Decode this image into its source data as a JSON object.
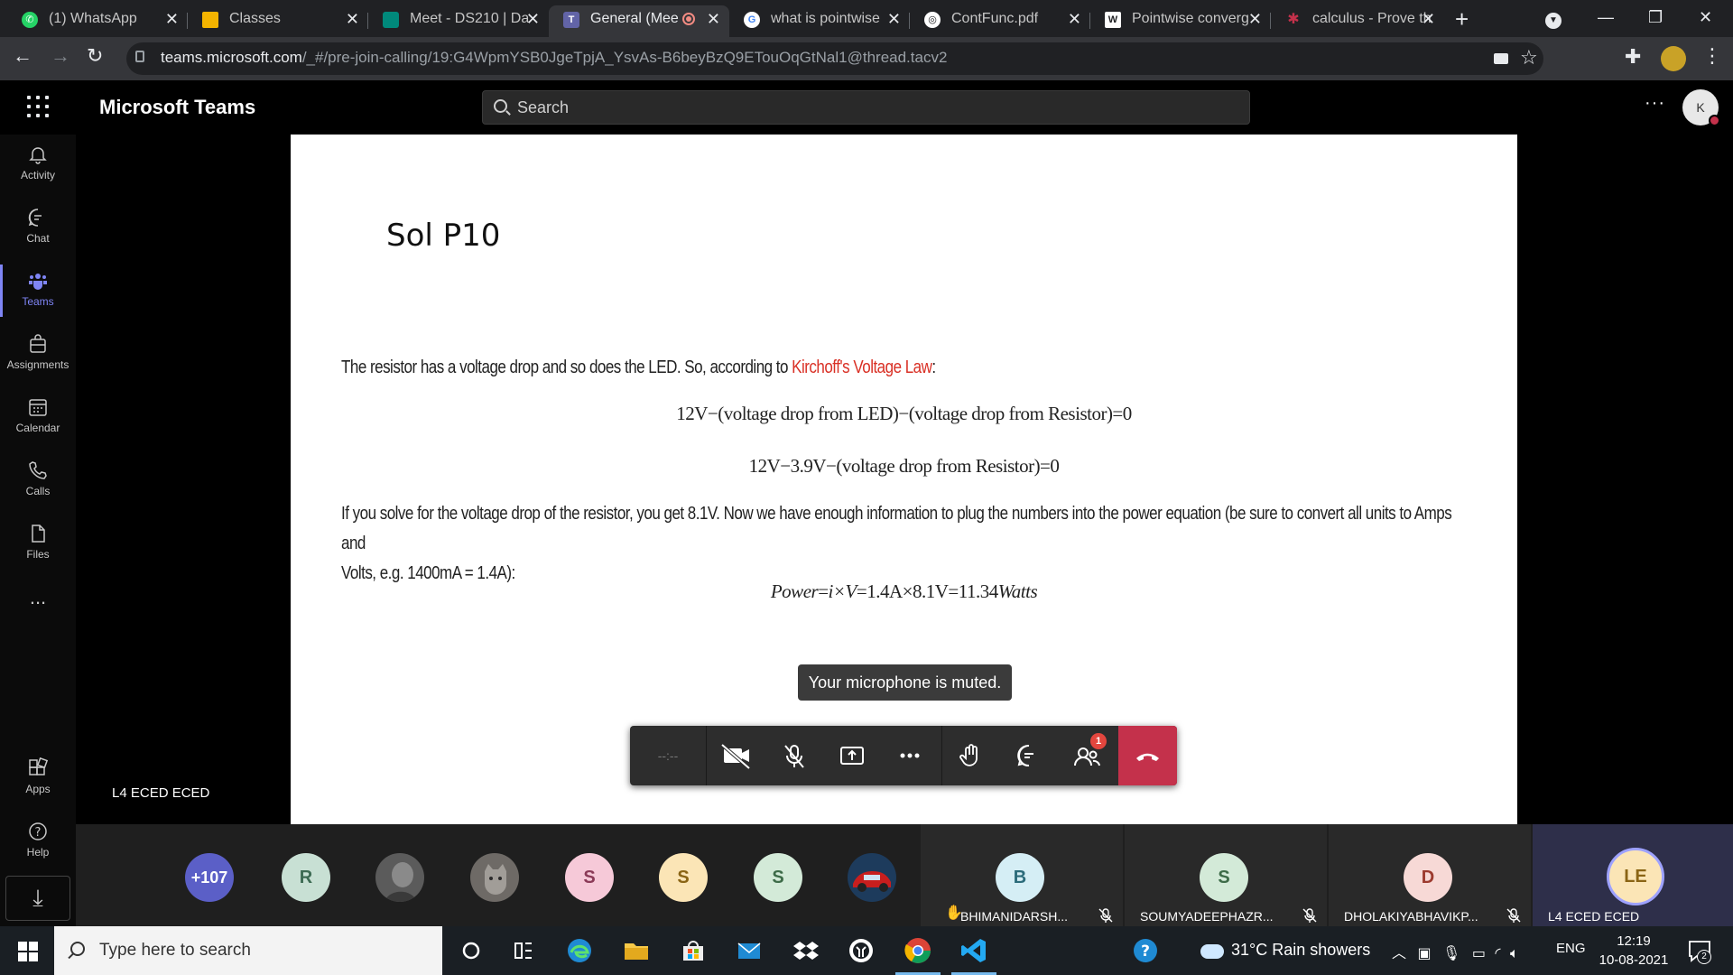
{
  "browser": {
    "tabs": [
      {
        "title": "(1) WhatsApp",
        "favicon": "whatsapp-icon",
        "color": "#25d366",
        "active": false
      },
      {
        "title": "Classes",
        "favicon": "classroom-icon",
        "color": "#f4b400",
        "active": false
      },
      {
        "title": "Meet - DS210 | Da",
        "favicon": "meet-icon",
        "color": "#00897b",
        "active": false
      },
      {
        "title": "General (Mee",
        "favicon": "teams-icon",
        "color": "#6264a7",
        "active": true,
        "recording": true
      },
      {
        "title": "what is pointwise",
        "favicon": "google-icon",
        "color": "#ffffff",
        "active": false
      },
      {
        "title": "ContFunc.pdf",
        "favicon": "globe-icon",
        "color": "#ffffff",
        "active": false
      },
      {
        "title": "Pointwise converg",
        "favicon": "wikipedia-icon",
        "color": "#ffffff",
        "active": false
      },
      {
        "title": "calculus - Prove th",
        "favicon": "stackexchange-icon",
        "color": "#c4314b",
        "active": false
      }
    ],
    "url_host": "teams.microsoft.com",
    "url_path": "/_#/pre-join-calling/19:G4WpmYSB0JgeTpjA_YsvAs-B6beyBzQ9ETouOqGtNal1@thread.tacv2"
  },
  "teams": {
    "app_title": "Microsoft Teams",
    "search_placeholder": "Search",
    "user_initial": "K",
    "rail": [
      {
        "label": "Activity",
        "icon": "bell-icon",
        "active": false
      },
      {
        "label": "Chat",
        "icon": "chat-icon",
        "active": false
      },
      {
        "label": "Teams",
        "icon": "teams-icon",
        "active": true
      },
      {
        "label": "Assignments",
        "icon": "assignments-icon",
        "active": false
      },
      {
        "label": "Calendar",
        "icon": "calendar-icon",
        "active": false
      },
      {
        "label": "Calls",
        "icon": "phone-icon",
        "active": false
      },
      {
        "label": "Files",
        "icon": "file-icon",
        "active": false
      },
      {
        "label": "...",
        "icon": "more-icon",
        "active": false
      },
      {
        "label": "Apps",
        "icon": "apps-icon",
        "active": false
      },
      {
        "label": "Help",
        "icon": "help-icon",
        "active": false
      }
    ],
    "accent": "#7f85f5"
  },
  "slide": {
    "title": "Sol P10",
    "p1_a": "The resistor has a voltage drop and so does the LED. So, according to ",
    "p1_link": "Kirchoff's Voltage Law",
    "p1_b": ":",
    "eq1": "12V−(voltage drop from LED)−(voltage drop from Resistor)=0",
    "eq2": "12V−3.9V−(voltage drop from Resistor)=0",
    "p2_line1": "If you solve for the voltage drop of the resistor, you get 8.1V. Now we have enough information to plug the numbers into the power equation (be sure to convert all units to Amps and",
    "p2_line2": "Volts, e.g. 1400mA = 1.4A):",
    "eq3_a": "Power",
    "eq3_b": "=",
    "eq3_c": "i×V",
    "eq3_d": "=1.4A×8.1V=11.34",
    "eq3_e": "Watts"
  },
  "meeting": {
    "toast": "Your microphone is muted.",
    "timer": "--:--",
    "participants_badge": "1",
    "presenter_name": "L4 ECED ECED",
    "more_count": "+107",
    "avatars": [
      {
        "initial": "R",
        "bg": "#c8e0d4",
        "fg": "#3d6b53"
      },
      {
        "initial": "",
        "bg": "#5b5b5b",
        "fg": "#fff",
        "photo": true
      },
      {
        "initial": "",
        "bg": "#6e6a66",
        "fg": "#fff",
        "photo": true
      },
      {
        "initial": "S",
        "bg": "#f6c9d8",
        "fg": "#8b3a57"
      },
      {
        "initial": "S",
        "bg": "#fbe5b6",
        "fg": "#8a6414"
      },
      {
        "initial": "S",
        "bg": "#d3ead8",
        "fg": "#3d6b48"
      },
      {
        "initial": "",
        "bg": "#a02020",
        "fg": "#fff",
        "photo": true
      }
    ],
    "tiles": [
      {
        "initial": "B",
        "name": "BHIMANIDARSH...",
        "bg": "#d5eef5",
        "fg": "#2b6b7a",
        "hand": true
      },
      {
        "initial": "S",
        "name": "SOUMYADEEPHAZR...",
        "bg": "#d3ead8",
        "fg": "#3d6b48",
        "hand": false
      },
      {
        "initial": "D",
        "name": "DHOLAKIYABHAVIKP...",
        "bg": "#f7d9d6",
        "fg": "#9c3a2e",
        "hand": false
      },
      {
        "initial": "LE",
        "name": "L4 ECED ECED",
        "bg": "#fbe5b6",
        "fg": "#8a6414",
        "hand": false
      }
    ]
  },
  "taskbar": {
    "search_placeholder": "Type here to search",
    "weather": "31°C  Rain showers",
    "lang": "ENG",
    "time": "12:19",
    "date": "10-08-2021",
    "notifications": "2"
  }
}
